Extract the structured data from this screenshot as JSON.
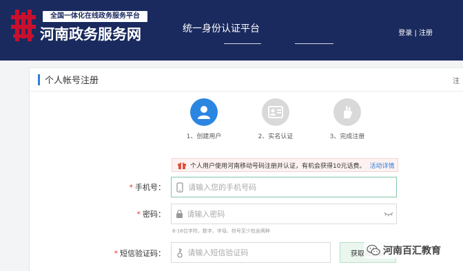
{
  "header": {
    "logo_subtitle": "全国一体化在线政务服务平台",
    "logo_title": "河南政务服务网",
    "platform_title": "统一身份认证平台",
    "login_link": "登录",
    "separator": "|",
    "register_link": "注册"
  },
  "card": {
    "title": "个人帐号注册",
    "right_note": "注"
  },
  "steps": [
    {
      "label": "1、创建用户",
      "icon": "user-icon",
      "active": true
    },
    {
      "label": "2、实名认证",
      "icon": "id-card-icon",
      "active": false
    },
    {
      "label": "3、完成注册",
      "icon": "check-hand-icon",
      "active": false
    }
  ],
  "promo": {
    "icon": "gift-icon",
    "text": "个人用户使用河南移动号码注册并认证，有机会获得10元话费。",
    "detail_link": "活动详情"
  },
  "form": {
    "phone": {
      "label": "手机号：",
      "placeholder": "请输入您的手机号码",
      "icon": "phone-icon"
    },
    "password": {
      "label": "密码：",
      "placeholder": "请输入密码",
      "icon": "lock-icon",
      "toggle_icon": "eye-icon",
      "hint": "8-16位字符，数字、字母、符号至少包含两种"
    },
    "sms": {
      "label": "短信验证码：",
      "placeholder": "请输入短信验证码",
      "icon": "key-icon",
      "button": "获取验证码"
    },
    "required_mark": "*"
  },
  "watermark": {
    "text": "河南百汇教育",
    "icon": "wechat-icon"
  },
  "colors": {
    "header_bg": "#1a2a5e",
    "accent": "#2b86e2",
    "logo_red": "#c8102e"
  }
}
